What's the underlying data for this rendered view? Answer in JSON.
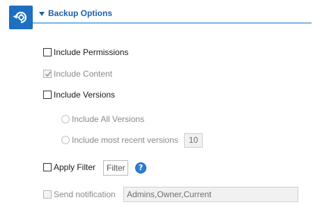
{
  "header": {
    "icon": "backup-settings-icon",
    "title": "Backup Options",
    "accent_color": "#1f5fa8"
  },
  "options": {
    "include_permissions": {
      "label": "Include Permissions",
      "checked": false,
      "enabled": true
    },
    "include_content": {
      "label": "Include Content",
      "checked": true,
      "enabled": false
    },
    "include_versions": {
      "label": "Include Versions",
      "checked": false,
      "enabled": true
    },
    "include_all_versions": {
      "label": "Include All Versions",
      "selected": false,
      "enabled": false
    },
    "include_recent_versions": {
      "label": "Include most recent versions",
      "selected": false,
      "enabled": false,
      "value": "10"
    },
    "apply_filter": {
      "label": "Apply Filter",
      "checked": false,
      "enabled": true,
      "placeholder": "Filter",
      "help_icon": "help-icon"
    },
    "send_notification": {
      "label": "Send notification",
      "checked": false,
      "enabled": false,
      "recipients": "Admins,Owner,Current"
    }
  }
}
